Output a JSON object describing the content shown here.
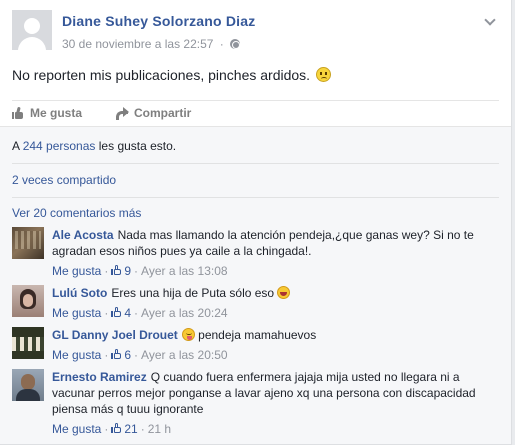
{
  "post": {
    "author": "Diane Suhey Solorzano Diaz",
    "timestamp": "30 de noviembre a las 22:57",
    "separator": "·",
    "text": "No reporten mis publicaciones, pinches ardidos.",
    "privacy_icon": "globe-icon",
    "menu_icon": "chevron-down-icon"
  },
  "actions": {
    "like_label": "Me gusta",
    "share_label": "Compartir"
  },
  "ufi": {
    "likes_prefix": "A",
    "likes_link": "244 personas",
    "likes_suffix": "les gusta esto.",
    "shares_text": "2 veces compartido",
    "more_comments": "Ver 20 comentarios más"
  },
  "comments": [
    {
      "name": "Ale Acosta",
      "text": "Nada mas llamando la atención pendeja,¿que ganas wey? Si no te agradan esos niños pues ya caile a la chingada!.",
      "like_label": "Me gusta",
      "likes": "9",
      "time": "Ayer a las 13:08",
      "dot": "·"
    },
    {
      "name": "Lulú Soto",
      "text": "Eres una hija de Puta sólo eso",
      "like_label": "Me gusta",
      "likes": "4",
      "time": "Ayer a las 20:24",
      "dot": "·"
    },
    {
      "name": "GL Danny Joel Drouet",
      "text": "pendeja mamahuevos",
      "like_label": "Me gusta",
      "likes": "6",
      "time": "Ayer a las 20:50",
      "dot": "·"
    },
    {
      "name": "Ernesto Ramirez",
      "text": "Q cuando fuera enfermera jajaja mija usted no llegara ni a vacunar perros mejor ponganse a lavar ajeno xq una persona con discapacidad piensa más q tuuu ignorante",
      "like_label": "Me gusta",
      "likes": "21",
      "time": "21 h",
      "dot": "·"
    }
  ],
  "colors": {
    "link": "#365899",
    "muted": "#90949c",
    "text": "#1d2129",
    "ufi_bg": "#f6f7f9"
  }
}
